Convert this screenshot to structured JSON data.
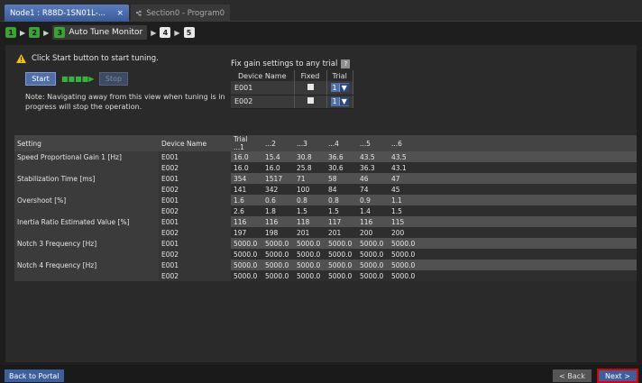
{
  "tabs": [
    {
      "label": "Node1 : R88D-1SN01L-... ",
      "close": "×",
      "active": true
    },
    {
      "label": "Section0 - Program0",
      "active": false
    }
  ],
  "breadcrumb": {
    "steps_done": [
      "1",
      "2",
      "3"
    ],
    "current_label": "Auto Tune Monitor",
    "steps_pending": [
      "4",
      "5"
    ],
    "arrow": "▶"
  },
  "instruction": "Click Start button to start tuning.",
  "buttons": {
    "start": "Start",
    "progress": "■■■■▶",
    "stop": "Stop",
    "back_to_portal": "Back to Portal",
    "back": "< Back",
    "next": "Next >"
  },
  "note": "Note: Navigating away from this view when tuning is in progress will stop the operation.",
  "fix_gain": {
    "title": "Fix gain settings to any trial",
    "help": "?",
    "headers": [
      "Device Name",
      "Fixed",
      "Trial"
    ],
    "rows": [
      {
        "device": "E001",
        "trial": "1",
        "dd": "▼"
      },
      {
        "device": "E002",
        "trial": "1",
        "dd": "▼"
      }
    ]
  },
  "results": {
    "headers": [
      "Setting",
      "Device Name",
      "Trial ...1",
      "...2",
      "...3",
      "...4",
      "...5",
      "...6"
    ],
    "rows": [
      {
        "setting": "Speed Proportional Gain 1 [Hz]",
        "device": "E001",
        "values": [
          "16.0",
          "15.4",
          "30.8",
          "36.6",
          "43.5",
          "43.5"
        ]
      },
      {
        "setting": "",
        "device": "E002",
        "values": [
          "16.0",
          "16.0",
          "25.8",
          "30.6",
          "36.3",
          "43.1"
        ]
      },
      {
        "setting": "Stabilization Time [ms]",
        "device": "E001",
        "values": [
          "354",
          "1517",
          "71",
          "58",
          "46",
          "47"
        ]
      },
      {
        "setting": "",
        "device": "E002",
        "values": [
          "141",
          "342",
          "100",
          "84",
          "74",
          "45"
        ]
      },
      {
        "setting": "Overshoot [%]",
        "device": "E001",
        "values": [
          "1.6",
          "0.6",
          "0.8",
          "0.8",
          "0.9",
          "1.1"
        ]
      },
      {
        "setting": "",
        "device": "E002",
        "values": [
          "2.6",
          "1.8",
          "1.5",
          "1.5",
          "1.4",
          "1.5"
        ]
      },
      {
        "setting": "Inertia Ratio Estimated Value [%]",
        "device": "E001",
        "values": [
          "116",
          "116",
          "118",
          "117",
          "116",
          "115"
        ]
      },
      {
        "setting": "",
        "device": "E002",
        "values": [
          "197",
          "198",
          "201",
          "201",
          "200",
          "200"
        ]
      },
      {
        "setting": "Notch 3 Frequency [Hz]",
        "device": "E001",
        "values": [
          "5000.0",
          "5000.0",
          "5000.0",
          "5000.0",
          "5000.0",
          "5000.0"
        ]
      },
      {
        "setting": "",
        "device": "E002",
        "values": [
          "5000.0",
          "5000.0",
          "5000.0",
          "5000.0",
          "5000.0",
          "5000.0"
        ]
      },
      {
        "setting": "Notch 4 Frequency [Hz]",
        "device": "E001",
        "values": [
          "5000.0",
          "5000.0",
          "5000.0",
          "5000.0",
          "5000.0",
          "5000.0"
        ]
      },
      {
        "setting": "",
        "device": "E002",
        "values": [
          "5000.0",
          "5000.0",
          "5000.0",
          "5000.0",
          "5000.0",
          "5000.0"
        ]
      }
    ]
  }
}
